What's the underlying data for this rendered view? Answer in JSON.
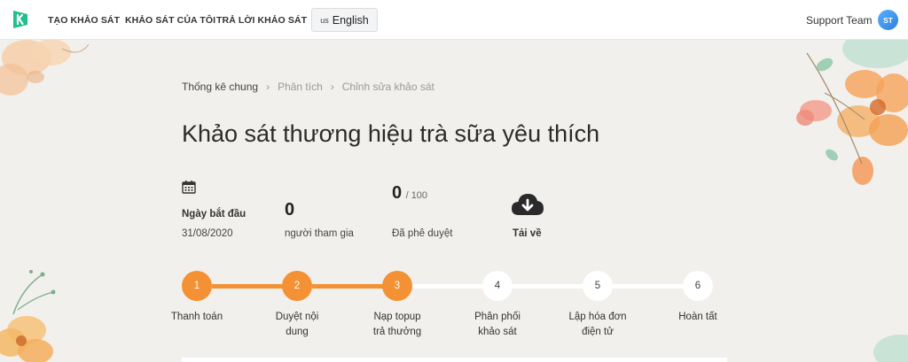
{
  "header": {
    "nav": [
      {
        "label": "TẠO KHẢO SÁT"
      },
      {
        "label": "KHẢO SÁT CỦA TÔI"
      },
      {
        "label": "TRẢ LỜI KHẢO SÁT"
      }
    ],
    "language": {
      "flag": "us",
      "label": "English"
    },
    "user": {
      "name": "Support Team",
      "initials": "ST"
    }
  },
  "breadcrumb": [
    "Thống kê chung",
    "Phân tích",
    "Chỉnh sửa khảo sát"
  ],
  "title": "Khảo sát thương hiệu trà sữa yêu thích",
  "stats": {
    "start": {
      "label": "Ngày bắt đầu",
      "value": "31/08/2020",
      "icon": "calendar-icon"
    },
    "participants": {
      "value": "0",
      "label": "người tham gia"
    },
    "approved": {
      "value": "0",
      "total": "/ 100",
      "label": "Đã phê duyệt"
    },
    "download": {
      "label": "Tải về",
      "icon": "cloud-download-icon"
    }
  },
  "steps": [
    {
      "num": "1",
      "line1": "Thanh toán",
      "line2": "",
      "status": "done"
    },
    {
      "num": "2",
      "line1": "Duyệt nội",
      "line2": "dung",
      "status": "done"
    },
    {
      "num": "3",
      "line1": "Nạp topup",
      "line2": "trả thưởng",
      "status": "done"
    },
    {
      "num": "4",
      "line1": "Phân phối",
      "line2": "khảo sát",
      "status": "todo"
    },
    {
      "num": "5",
      "line1": "Lập hóa đơn",
      "line2": "điện tử",
      "status": "todo"
    },
    {
      "num": "6",
      "line1": "Hoàn tất",
      "line2": "",
      "status": "todo"
    }
  ],
  "colors": {
    "accent": "#f39134",
    "brand": "#1fbf8f",
    "avatar": "#3a8ee6"
  }
}
